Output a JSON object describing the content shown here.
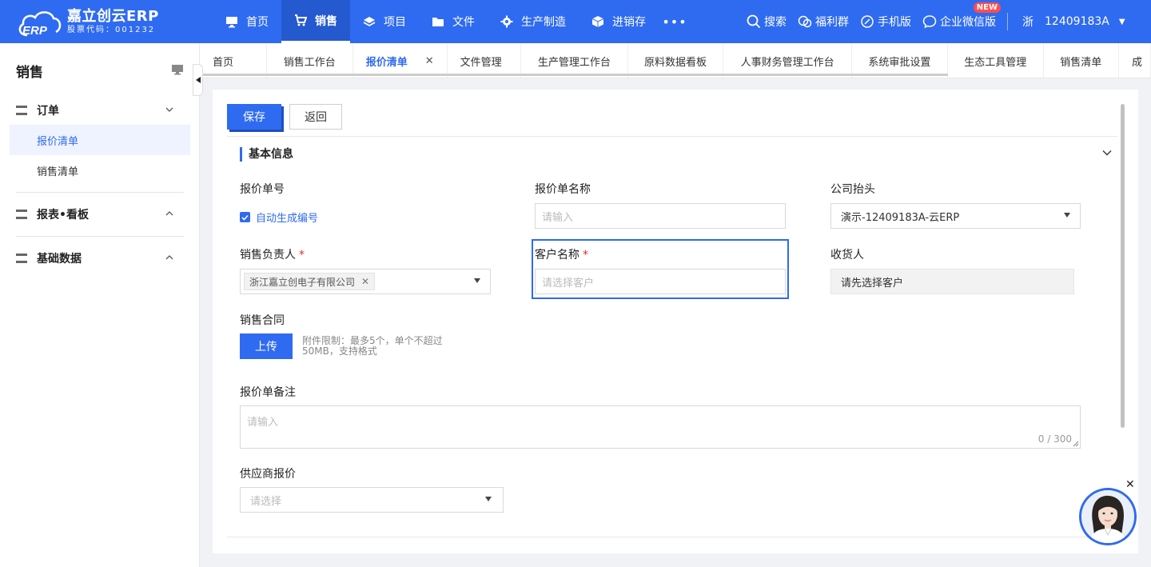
{
  "brand": {
    "name": "嘉立创云ERP",
    "stock_code": "股票代码：001232",
    "logo_letters": "ERP"
  },
  "nav": [
    {
      "label": "首页",
      "icon": "monitor-icon",
      "active": false
    },
    {
      "label": "销售",
      "icon": "cart-icon",
      "active": true
    },
    {
      "label": "项目",
      "icon": "layers-icon",
      "active": false
    },
    {
      "label": "文件",
      "icon": "folder-icon",
      "active": false
    },
    {
      "label": "生产制造",
      "icon": "gear-icon",
      "active": false
    },
    {
      "label": "进销存",
      "icon": "box-icon",
      "active": false
    }
  ],
  "nav_more": "•••",
  "top_right": {
    "search": "搜索",
    "welfare": "福利群",
    "mobile": "手机版",
    "wechat": "企业微信版",
    "new_badge": "NEW",
    "user_province": "浙",
    "user_id": "12409183A"
  },
  "sidebar": {
    "title": "销售",
    "groups": [
      {
        "label": "订单",
        "expanded": true,
        "items": [
          "报价清单",
          "销售清单"
        ]
      },
      {
        "label": "报表•看板",
        "expanded": false
      },
      {
        "label": "基础数据",
        "expanded": false
      }
    ],
    "active_item": "报价清单"
  },
  "tabs": [
    "首页",
    "销售工作台",
    "报价清单",
    "文件管理",
    "生产管理工作台",
    "原料数据看板",
    "人事财务管理工作台",
    "系统审批设置",
    "生态工具管理",
    "销售清单",
    "成"
  ],
  "active_tab": "报价清单",
  "toolbar": {
    "save": "保存",
    "back": "返回"
  },
  "form": {
    "section_title": "基本信息",
    "quote_no": {
      "label": "报价单号",
      "auto_label": "自动生成编号",
      "checked": true
    },
    "quote_name": {
      "label": "报价单名称",
      "placeholder": "请输入"
    },
    "company": {
      "label": "公司抬头",
      "value": "演示-12409183A-云ERP"
    },
    "salesperson": {
      "label": "销售负责人",
      "required": "*",
      "tag": "浙江嘉立创电子有限公司"
    },
    "customer": {
      "label": "客户名称",
      "required": "*",
      "placeholder": "请选择客户"
    },
    "receiver": {
      "label": "收货人",
      "value": "请先选择客户"
    },
    "contract": {
      "label": "销售合同",
      "upload": "上传",
      "hint_line1": "附件限制：最多5个，单个不超过",
      "hint_line2": "50MB，支持格式"
    },
    "remark": {
      "label": "报价单备注",
      "placeholder": "请输入",
      "counter": "0 / 300"
    },
    "supplier_quote": {
      "label": "供应商报价",
      "placeholder": "请选择"
    }
  },
  "colors": {
    "primary": "#2f6bf0",
    "required": "#f5222d",
    "badge": "#ff4d4f"
  }
}
